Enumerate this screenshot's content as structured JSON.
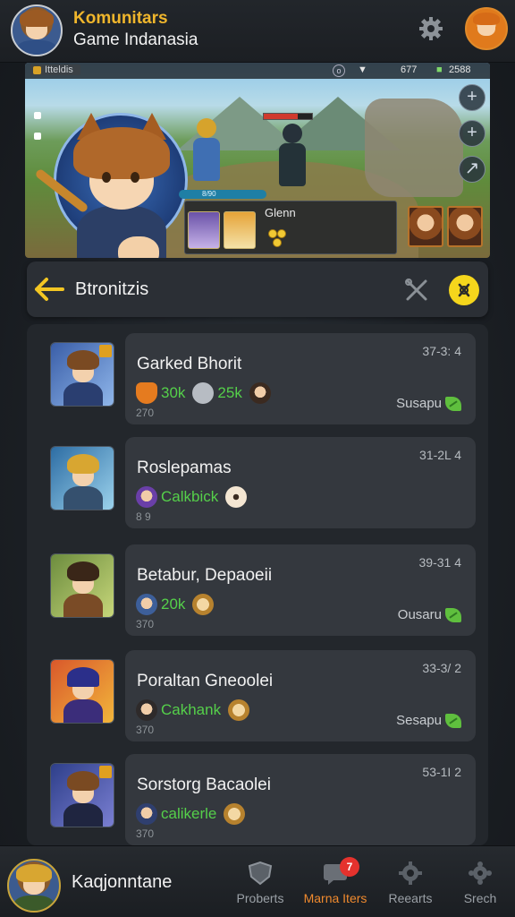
{
  "header": {
    "title": "Komunitars",
    "subtitle": "Game Indanasia",
    "gear_icon": "gear-icon",
    "profile_icon": "profile-avatar"
  },
  "banner": {
    "tab_label": "Itteldis",
    "stat_1": "677",
    "stat_2": "2588",
    "card_label": "Glenn",
    "mini_bar_label": "8/90"
  },
  "section": {
    "title": "Btronitzis",
    "back_icon": "arrow-left-icon",
    "tools_icon": "tools-icon",
    "action_icon": "close-icon",
    "accent": "#f5d61c"
  },
  "items": [
    {
      "name": "Garked Bhorit",
      "time": "37-3: 4",
      "stats": [
        {
          "icon": "shield-icon",
          "value": "30k"
        },
        {
          "icon": "helmet-icon",
          "value": "25k"
        },
        {
          "icon": "avatar-icon",
          "value": ""
        }
      ],
      "sub": "270",
      "action": "Susapu"
    },
    {
      "name": "Roslepamas",
      "time": "31-2L 4",
      "stats": [
        {
          "icon": "avatar-icon",
          "value": "Calkbick"
        },
        {
          "icon": "cookie-icon",
          "value": ""
        }
      ],
      "sub": "8 9",
      "action": ""
    },
    {
      "name": "Betabur, Depaoeii",
      "time": "39-31 4",
      "stats": [
        {
          "icon": "avatar-icon",
          "value": "20k"
        },
        {
          "icon": "clock-icon",
          "value": ""
        }
      ],
      "sub": "370",
      "action": "Ousaru"
    },
    {
      "name": "Poraltan Gneoolei",
      "time": "33-3/ 2",
      "stats": [
        {
          "icon": "avatar-icon",
          "value": "Cakhank"
        },
        {
          "icon": "clock-icon",
          "value": ""
        }
      ],
      "sub": "370",
      "action": "Sesapu"
    },
    {
      "name": "Sorstorg Bacaolei",
      "time": "53-1I 2",
      "stats": [
        {
          "icon": "avatar-icon",
          "value": "calikerle"
        },
        {
          "icon": "clock-icon",
          "value": ""
        }
      ],
      "sub": "370",
      "action": ""
    }
  ],
  "nav": {
    "username": "Kaqjonntane",
    "tabs": [
      {
        "label": "Proberts",
        "icon": "shield-icon",
        "badge": ""
      },
      {
        "label": "Marna Iters",
        "icon": "chat-icon",
        "badge": "7"
      },
      {
        "label": "Reearts",
        "icon": "gear-icon",
        "badge": ""
      },
      {
        "label": "Srech",
        "icon": "cog-icon",
        "badge": ""
      }
    ],
    "active_color": "#f08a2e"
  }
}
